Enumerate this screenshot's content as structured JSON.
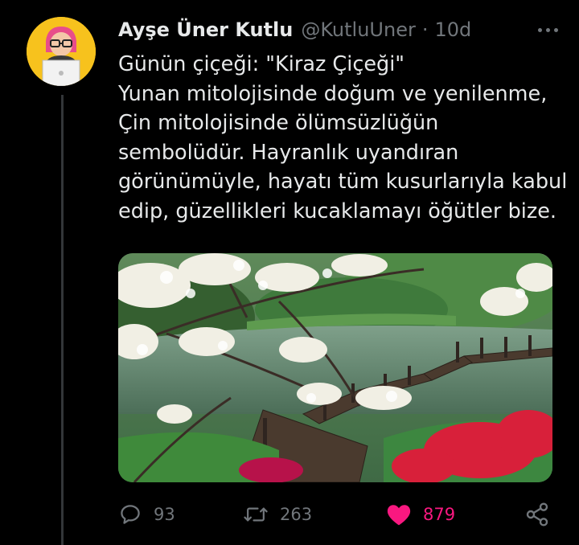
{
  "tweet": {
    "author_name": "Ayşe Üner Kutlu",
    "handle": "@KutluUner",
    "separator": "·",
    "time": "10d",
    "text_lines": [
      "Günün çiçeği: \"Kiraz Çiçeği\"",
      "Yunan mitolojisinde doğum ve yenilenme,",
      "Çin mitolojisinde ölümsüzlüğün",
      "sembolüdür. Hayranlık uyandıran",
      "görünümüyle, hayatı tüm kusurlarıyla kabul",
      "edip, güzellikleri kucaklamayı öğütler bize."
    ]
  },
  "actions": {
    "replies": "93",
    "retweets": "263",
    "likes": "879",
    "liked": true
  },
  "icons": {
    "reply": "reply-icon",
    "retweet": "retweet-icon",
    "like": "heart-filled-icon",
    "share": "share-icon",
    "more": "more-horizontal-icon"
  },
  "colors": {
    "background": "#000000",
    "text": "#e7e9ea",
    "secondary": "#71767b",
    "like": "#f91880",
    "thread_line": "#333639",
    "avatar_bg": "#f7c21d"
  }
}
